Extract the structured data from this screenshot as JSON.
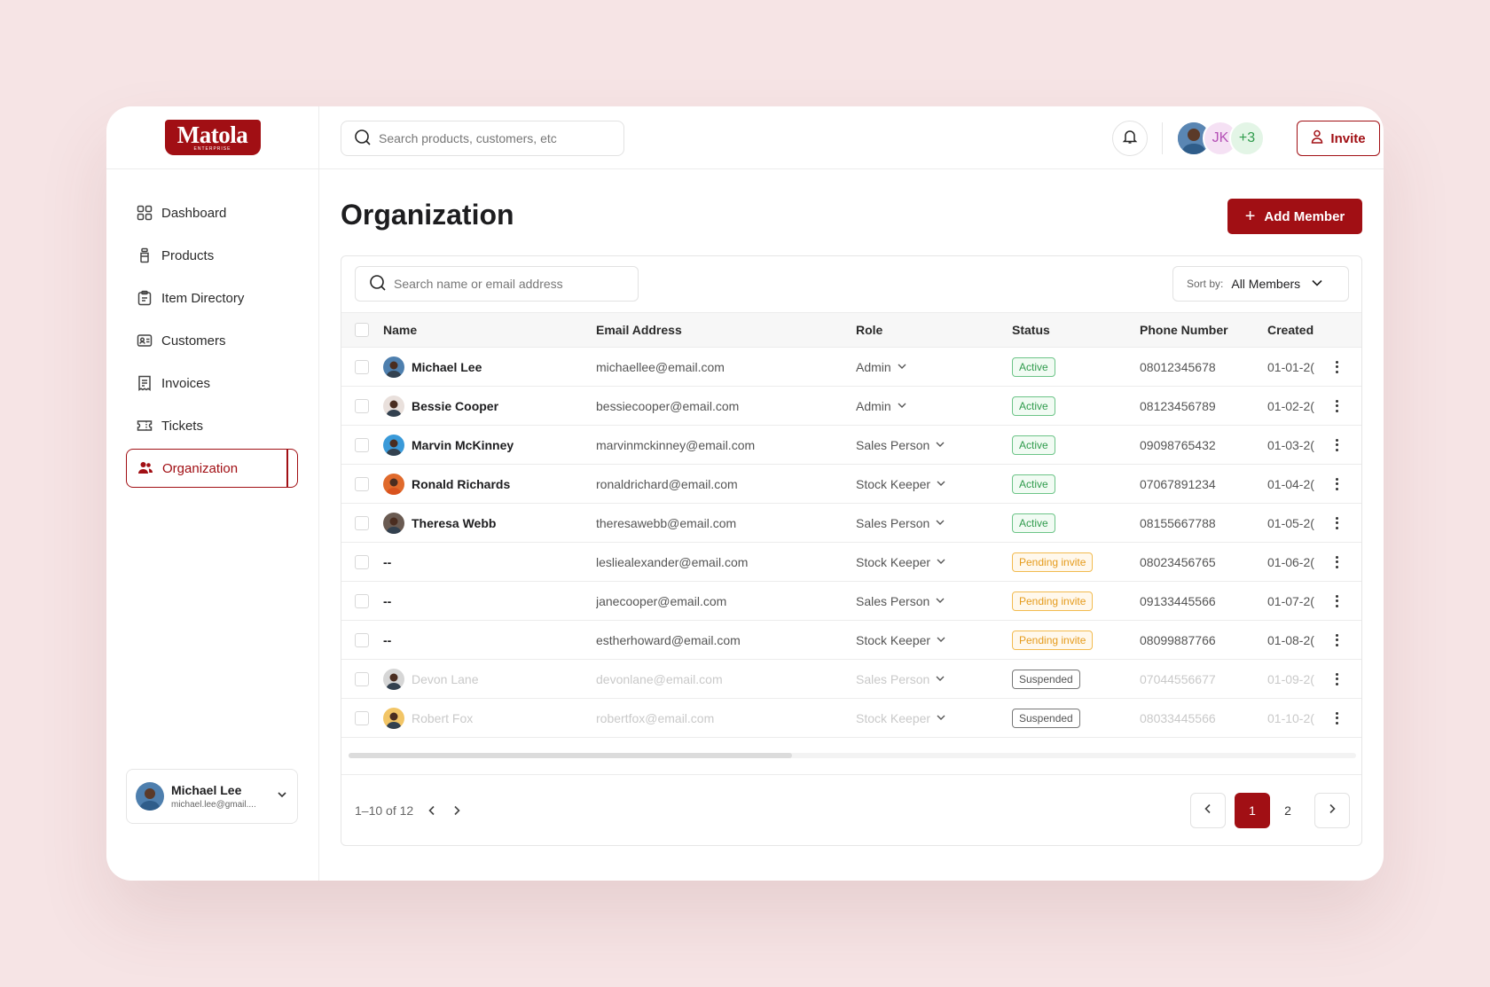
{
  "brand": {
    "name": "Matola",
    "tagline": "ENTERPRISE"
  },
  "sidebar": {
    "items": [
      {
        "label": "Dashboard",
        "icon": "grid-icon"
      },
      {
        "label": "Products",
        "icon": "bottle-icon"
      },
      {
        "label": "Item Directory",
        "icon": "clipboard-icon"
      },
      {
        "label": "Customers",
        "icon": "contact-card-icon"
      },
      {
        "label": "Invoices",
        "icon": "receipt-icon"
      },
      {
        "label": "Tickets",
        "icon": "ticket-icon"
      },
      {
        "label": "Organization",
        "icon": "users-icon",
        "active": true
      }
    ],
    "user": {
      "name": "Michael Lee",
      "email": "michael.lee@gmail...."
    }
  },
  "topbar": {
    "search_placeholder": "Search products, customers, etc",
    "avatars": {
      "initials": "JK",
      "more": "+3"
    },
    "invite_label": "Invite"
  },
  "page": {
    "title": "Organization",
    "add_label": "Add Member",
    "search_placeholder": "Search name or email address",
    "sort_label": "Sort by:",
    "sort_value": "All Members"
  },
  "table": {
    "headers": [
      "Name",
      "Email Address",
      "Role",
      "Status",
      "Phone Number",
      "Created"
    ],
    "rows": [
      {
        "name": "Michael Lee",
        "email": "michaellee@email.com",
        "role": "Admin",
        "status": "Active",
        "phone": "08012345678",
        "created": "01-01-2("
      },
      {
        "name": "Bessie Cooper",
        "email": "bessiecooper@email.com",
        "role": "Admin",
        "status": "Active",
        "phone": "08123456789",
        "created": "01-02-2("
      },
      {
        "name": "Marvin McKinney",
        "email": "marvinmckinney@email.com",
        "role": "Sales Person",
        "status": "Active",
        "phone": "09098765432",
        "created": "01-03-2("
      },
      {
        "name": "Ronald Richards",
        "email": "ronaldrichard@email.com",
        "role": "Stock Keeper",
        "status": "Active",
        "phone": "07067891234",
        "created": "01-04-2("
      },
      {
        "name": "Theresa Webb",
        "email": "theresawebb@email.com",
        "role": "Sales Person",
        "status": "Active",
        "phone": "08155667788",
        "created": "01-05-2("
      },
      {
        "name": "--",
        "email": "lesliealexander@email.com",
        "role": "Stock Keeper",
        "status": "Pending invite",
        "phone": "08023456765",
        "created": "01-06-2("
      },
      {
        "name": "--",
        "email": "janecooper@email.com",
        "role": "Sales Person",
        "status": "Pending invite",
        "phone": "09133445566",
        "created": "01-07-2("
      },
      {
        "name": "--",
        "email": "estherhoward@email.com",
        "role": "Stock Keeper",
        "status": "Pending invite",
        "phone": "08099887766",
        "created": "01-08-2("
      },
      {
        "name": "Devon Lane",
        "email": "devonlane@email.com",
        "role": "Sales Person",
        "status": "Suspended",
        "phone": "07044556677",
        "created": "01-09-2("
      },
      {
        "name": "Robert Fox",
        "email": "robertfox@email.com",
        "role": "Stock Keeper",
        "status": "Suspended",
        "phone": "08033445566",
        "created": "01-10-2("
      }
    ]
  },
  "pagination": {
    "range": "1–10 of 12",
    "pages": [
      "1",
      "2"
    ],
    "current": "1"
  },
  "colors": {
    "accent": "#a10f14",
    "active": "#2f9b4c",
    "pending": "#e59b1c",
    "background": "#f6e4e5"
  }
}
